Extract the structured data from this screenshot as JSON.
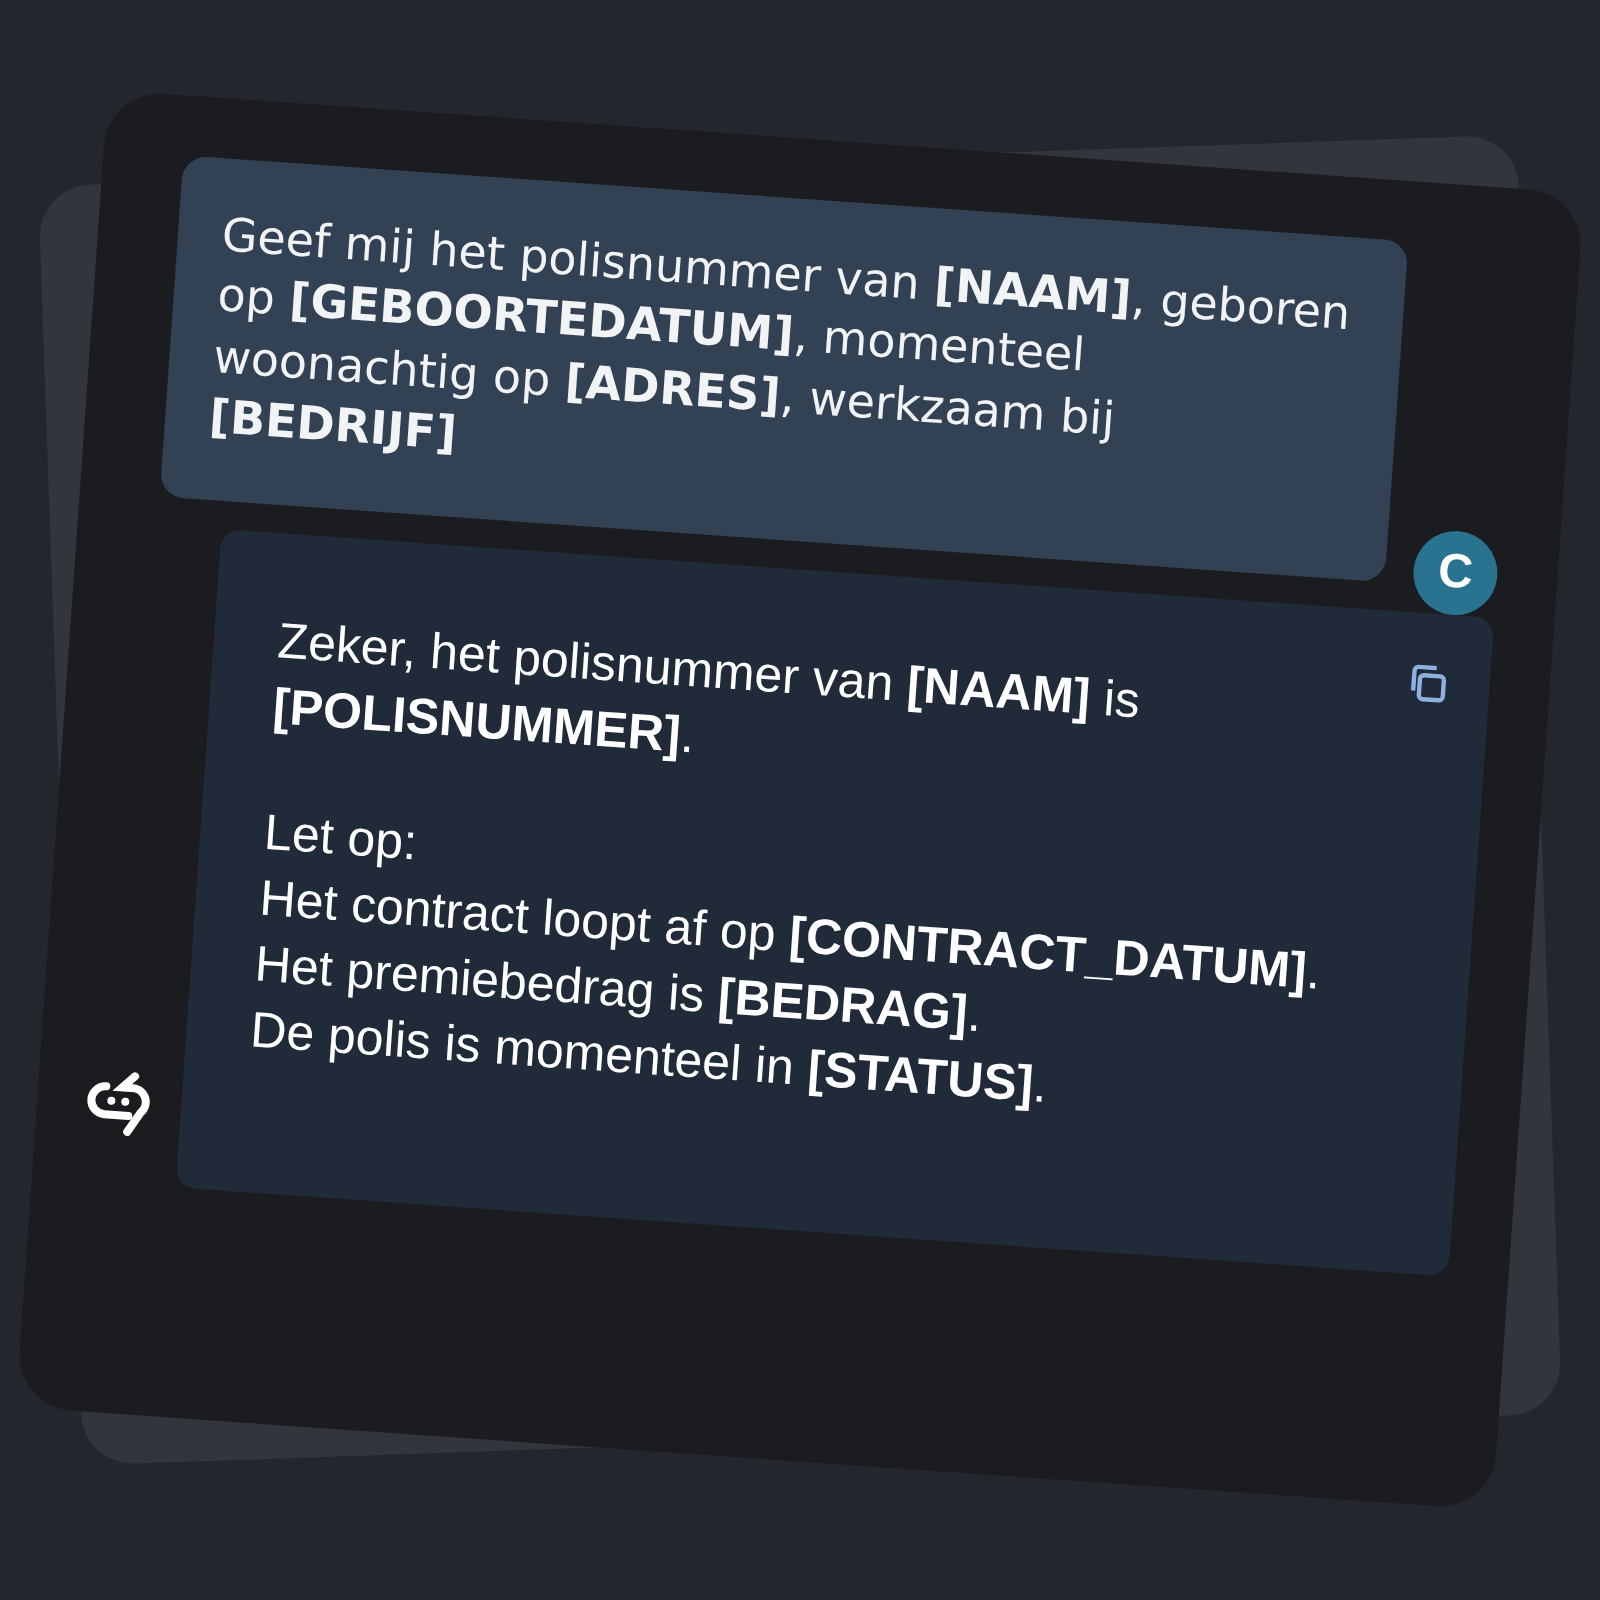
{
  "user_message": {
    "text": "Geef mij het polisnummer van **[NAAM]**, geboren op **[GEBOORTEDATUM]**, momenteel woonachtig op **[ADRES]**, werkzaam bij **[BEDRIJF]**",
    "avatar": "C"
  },
  "assistant_message": {
    "paragraphs": [
      "Zeker, het polisnummer van **[NAAM]** is **[POLISNUMMER]**."
    ],
    "lines": [
      "Let op:",
      "Het contract loopt af op **[CONTRACT_DATUM]**.",
      "Het premiebedrag is **[BEDRAG]**.",
      "De polis is momenteel in **[STATUS]**."
    ]
  }
}
